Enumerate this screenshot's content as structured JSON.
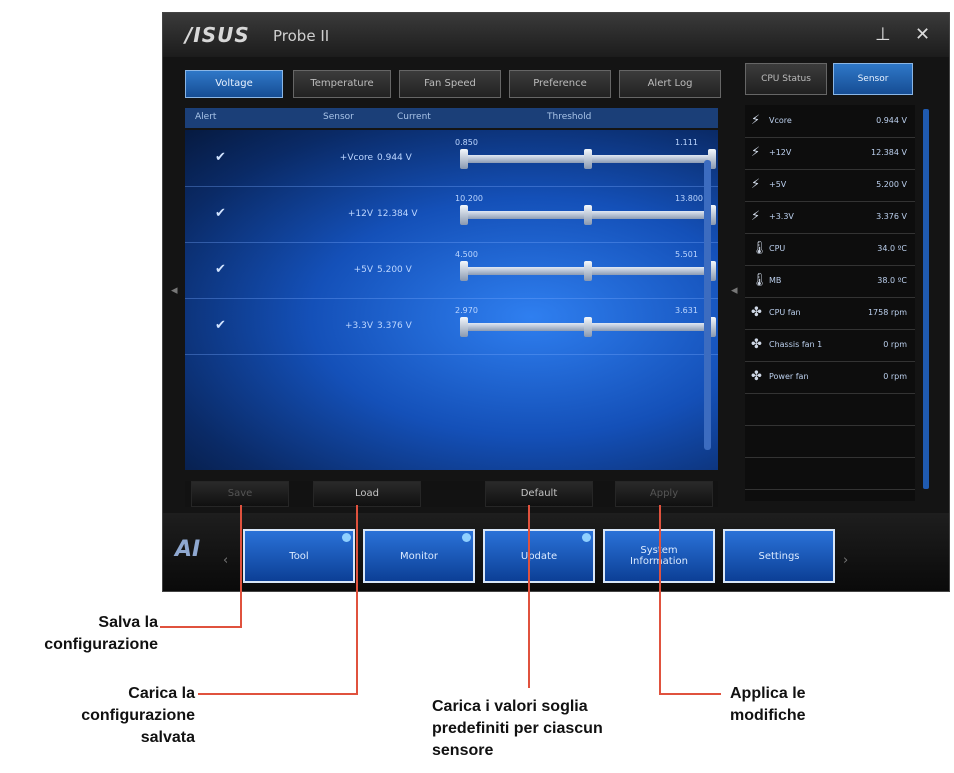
{
  "window": {
    "logo": "/ISUS",
    "title": "Probe II",
    "pin_glyph": "⊥",
    "close_glyph": "✕"
  },
  "tabs": [
    "Voltage",
    "Temperature",
    "Fan Speed",
    "Preference",
    "Alert Log"
  ],
  "columns": {
    "alert": "Alert",
    "sensor": "Sensor",
    "current": "Current",
    "threshold": "Threshold"
  },
  "rows": [
    {
      "sensor": "+Vcore",
      "current": "0.944 V",
      "low": "0.850",
      "high": "1.111"
    },
    {
      "sensor": "+12V",
      "current": "12.384 V",
      "low": "10.200",
      "high": "13.800"
    },
    {
      "sensor": "+5V",
      "current": "5.200 V",
      "low": "4.500",
      "high": "5.501"
    },
    {
      "sensor": "+3.3V",
      "current": "3.376 V",
      "low": "2.970",
      "high": "3.631"
    }
  ],
  "actions": {
    "save": "Save",
    "load": "Load",
    "default": "Default",
    "apply": "Apply"
  },
  "right_tabs": [
    "CPU Status",
    "Sensor"
  ],
  "sensors": [
    {
      "icon": "bolt-icon",
      "name": "Vcore",
      "value": "0.944 V"
    },
    {
      "icon": "bolt-icon",
      "name": "+12V",
      "value": "12.384 V"
    },
    {
      "icon": "bolt-icon",
      "name": "+5V",
      "value": "5.200 V"
    },
    {
      "icon": "bolt-icon",
      "name": "+3.3V",
      "value": "3.376 V"
    },
    {
      "icon": "thermometer-icon",
      "name": "CPU",
      "value": "34.0 ºC"
    },
    {
      "icon": "thermometer-icon",
      "name": "MB",
      "value": "38.0 ºC"
    },
    {
      "icon": "fan-icon",
      "name": "CPU fan",
      "value": "1758 rpm"
    },
    {
      "icon": "fan-icon",
      "name": "Chassis fan 1",
      "value": "0 rpm"
    },
    {
      "icon": "fan-icon",
      "name": "Power fan",
      "value": "0 rpm"
    }
  ],
  "bottom_logo": "AI",
  "nav": [
    "Tool",
    "Monitor",
    "Update",
    "System Information",
    "Settings"
  ],
  "annotations": {
    "save": "Salva la configurazione",
    "load": "Carica la configurazione salvata",
    "default": "Carica i valori soglia predefiniti per ciascun sensore",
    "apply": "Applica le modifiche"
  },
  "colors": {
    "accent": "#1f5fc8",
    "annotation_line": "#e0523e"
  }
}
